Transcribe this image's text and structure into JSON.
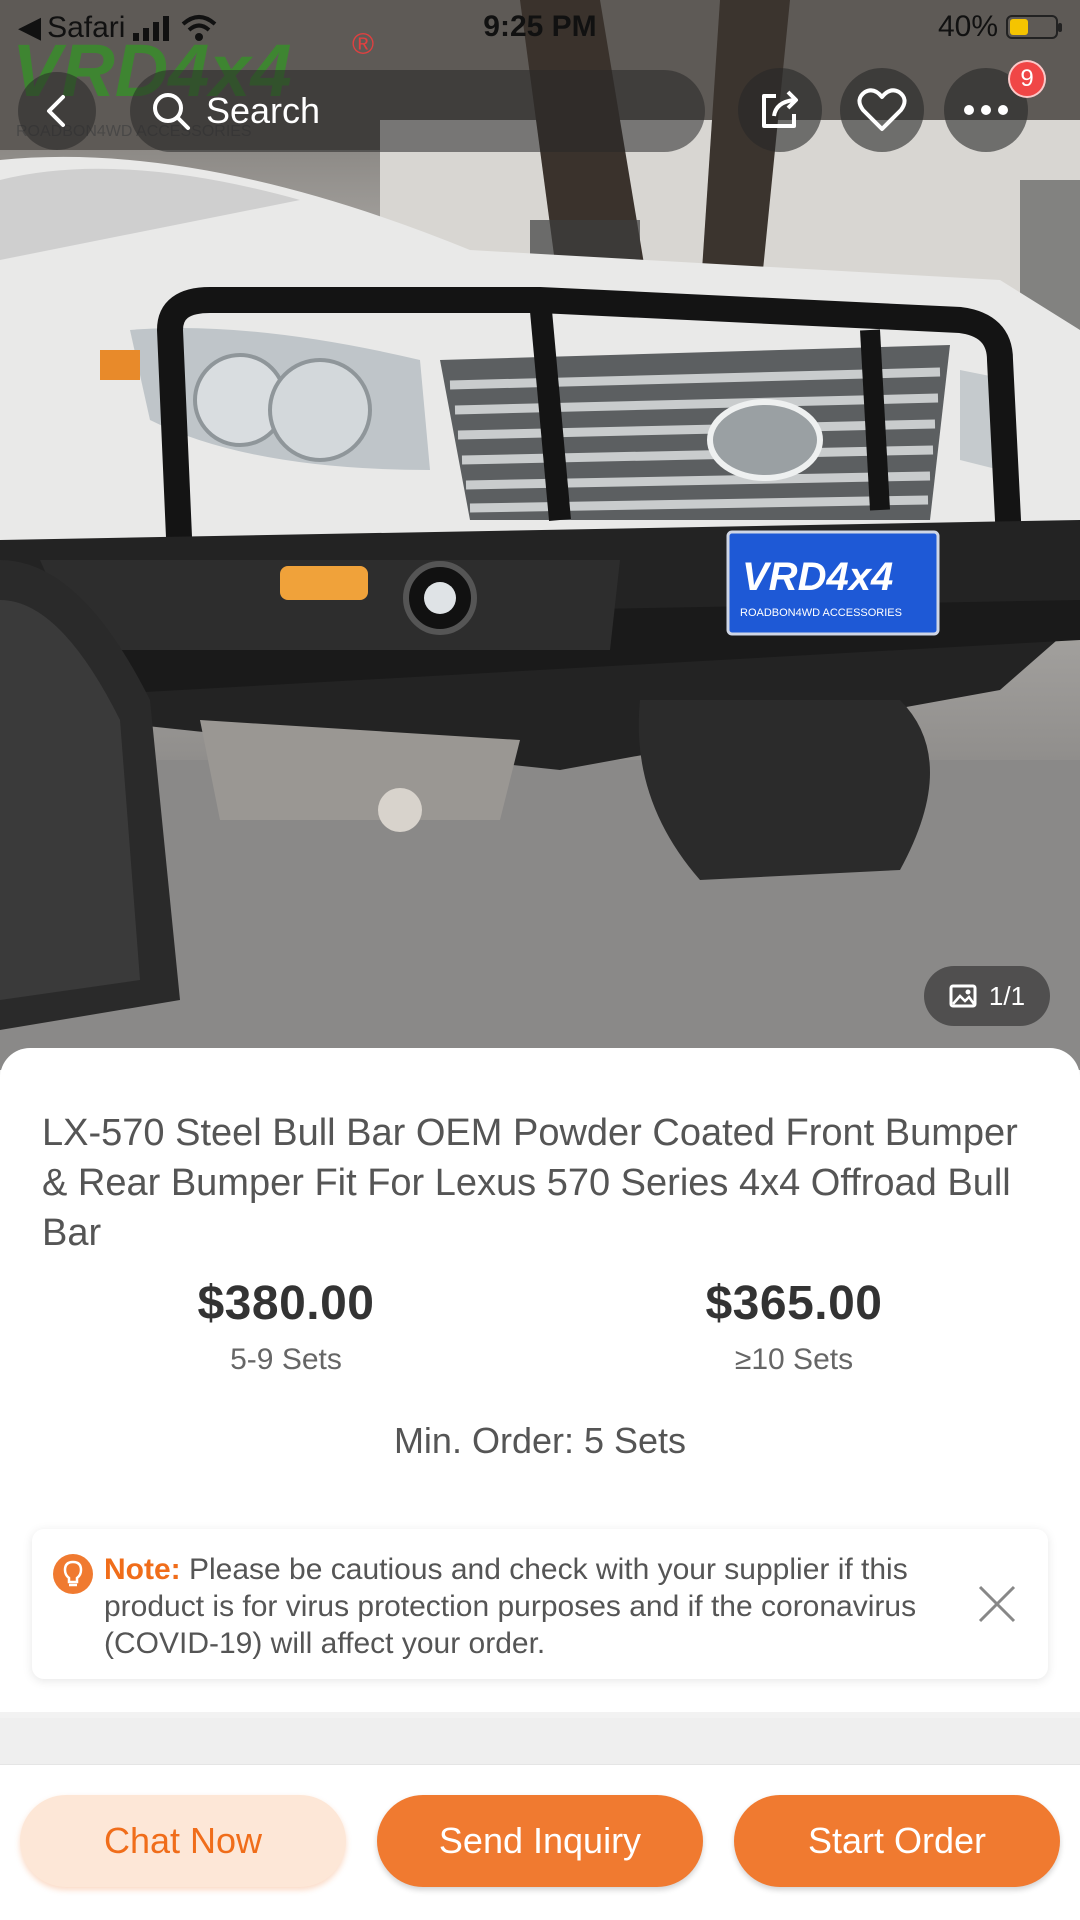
{
  "status_bar": {
    "back_app": "Safari",
    "time": "9:25 PM",
    "battery": "40%",
    "battery_level": 0.4
  },
  "hero": {
    "logo_text": "VRD4x4",
    "logo_registered": "®",
    "logo_tagline": "ROADBON4WD ACCESSORIES",
    "plate_text": "VRD4x4",
    "plate_tagline": "ROADBON4WD ACCESSORIES",
    "image_counter": "1/1"
  },
  "nav": {
    "search_label": "Search",
    "more_badge": "9"
  },
  "product": {
    "title": "LX-570 Steel Bull Bar OEM Powder Coated Front Bumper & Rear Bumper Fit For Lexus 570 Series 4x4 Offroad Bull Bar",
    "prices": [
      {
        "price": "$380.00",
        "qty": "5-9 Sets"
      },
      {
        "price": "$365.00",
        "qty": "≥10 Sets"
      }
    ],
    "min_order": "Min. Order: 5 Sets"
  },
  "note": {
    "label": "Note:",
    "text": " Please be cautious and check with your supplier if this product is for virus protection purposes and if the coronavirus (COVID-19) will affect your order."
  },
  "actions": {
    "chat": "Chat Now",
    "inquiry": "Send Inquiry",
    "order": "Start Order"
  },
  "colors": {
    "accent": "#f07a30",
    "accent_soft": "#fde7d7",
    "badge": "#f04646"
  }
}
